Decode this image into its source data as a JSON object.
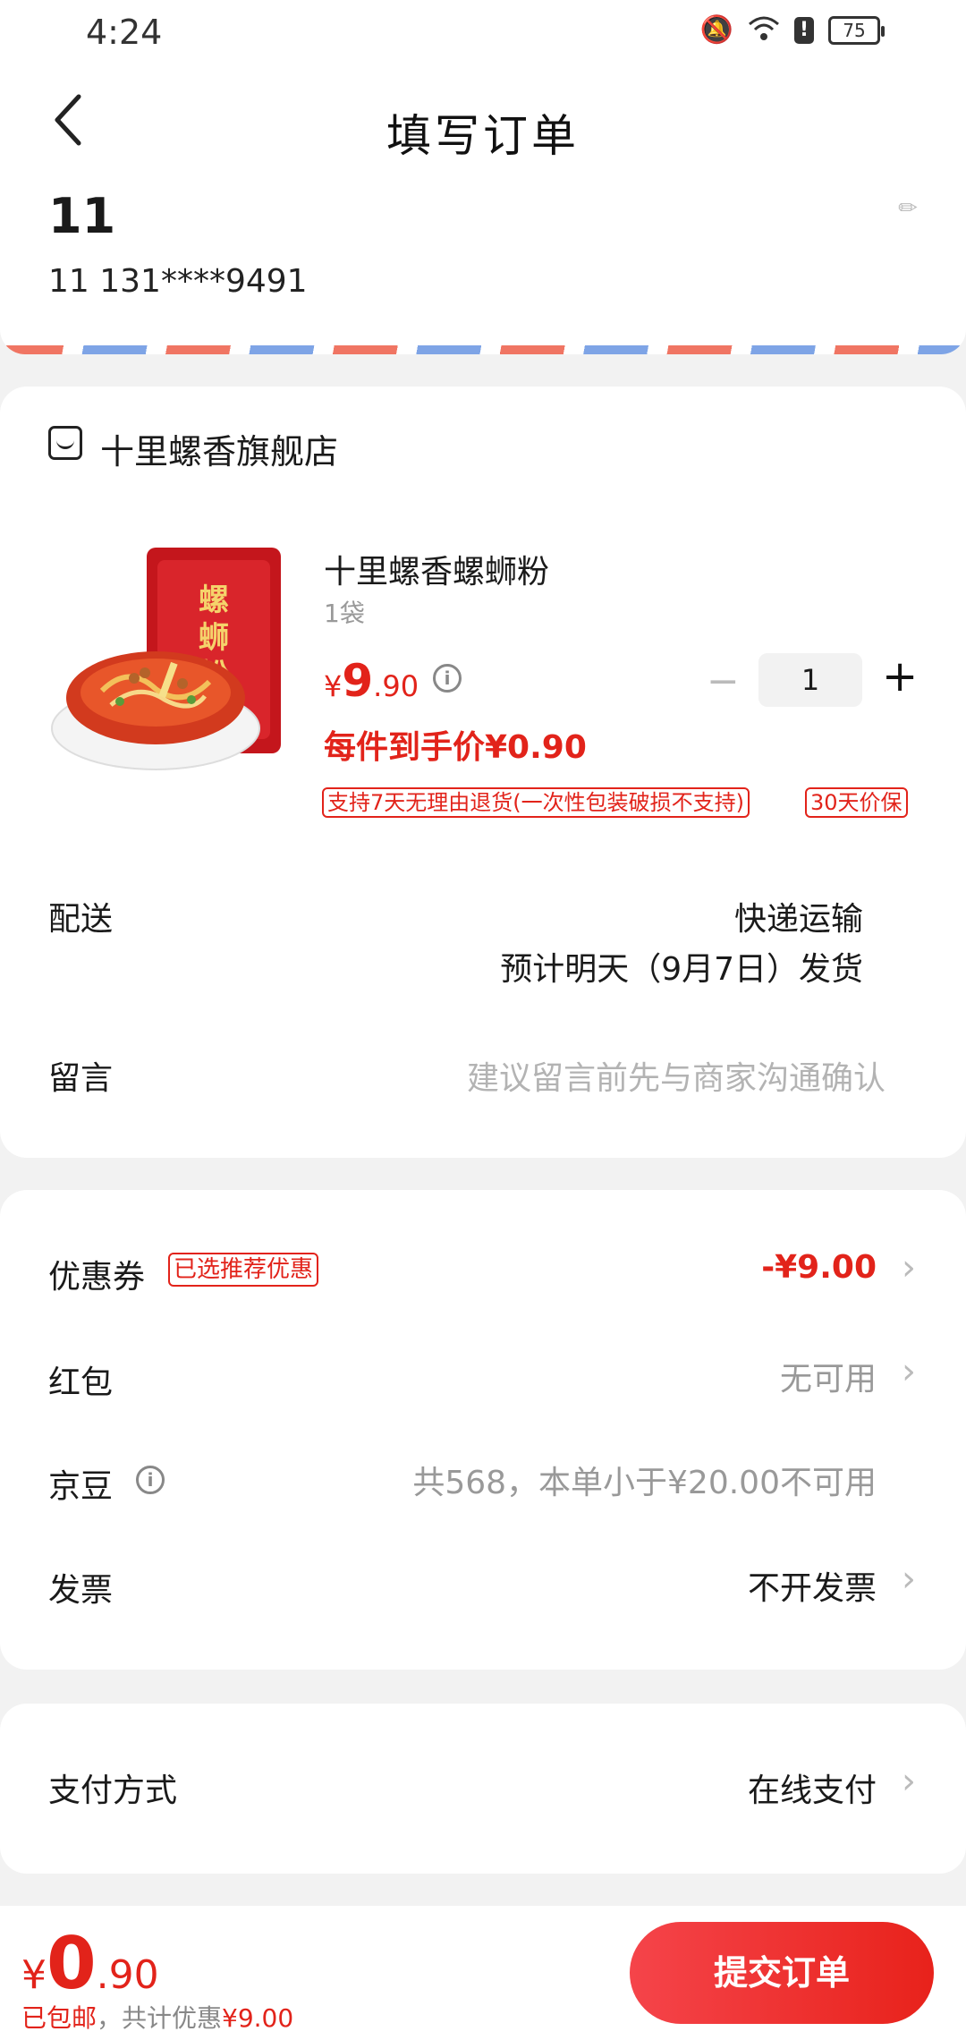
{
  "status_bar": {
    "time": "4:24",
    "battery": "75"
  },
  "header": {
    "title": "填写订单"
  },
  "address": {
    "name": "11",
    "contact": "11  131****9491"
  },
  "shop": {
    "name": "十里螺香旗舰店"
  },
  "product": {
    "title": "十里螺香螺蛳粉",
    "spec": "1袋",
    "price_symbol": "¥",
    "price_int": "9",
    "price_dec": ".90",
    "unit_price_text": "每件到手价¥0.90",
    "quantity": "1",
    "minus": "−",
    "plus": "+",
    "tags": [
      "支持7天无理由退货(一次性包装破损不支持)",
      "30天价保"
    ]
  },
  "delivery": {
    "label": "配送",
    "method": "快递运输",
    "estimate": "预计明天（9月7日）发货"
  },
  "message": {
    "label": "留言",
    "placeholder": "建议留言前先与商家沟通确认"
  },
  "benefits": {
    "coupon": {
      "label": "优惠券",
      "badge": "已选推荐优惠",
      "value": "-¥9.00"
    },
    "red_packet": {
      "label": "红包",
      "value": "无可用"
    },
    "jingdou": {
      "label": "京豆",
      "value": "共568，本单小于¥20.00不可用"
    },
    "invoice": {
      "label": "发票",
      "value": "不开发票"
    }
  },
  "payment": {
    "label": "支付方式",
    "value": "在线支付"
  },
  "bottom": {
    "symbol": "¥",
    "total_int": "0",
    "total_dec": ".90",
    "shipping": "已包邮",
    "saving_prefix": "，共计优惠",
    "saving_value": "¥9.00",
    "submit": "提交订单"
  },
  "colors": {
    "accent": "#e2231a",
    "background": "#f2f2f2"
  },
  "icons": [
    "back-arrow-icon",
    "mute-bell-icon",
    "wifi-icon",
    "alert-icon",
    "battery-icon",
    "shop-icon",
    "info-icon",
    "chevron-right-icon"
  ]
}
